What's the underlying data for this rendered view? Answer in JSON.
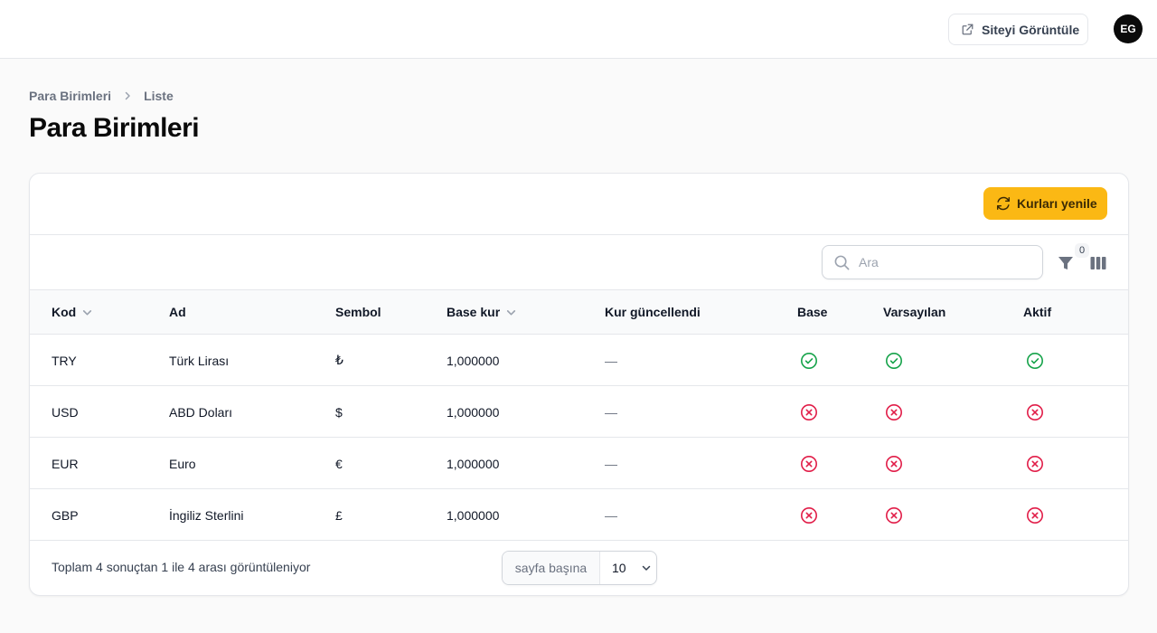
{
  "header": {
    "view_site_label": "Siteyi Görüntüle",
    "avatar_initials": "EG"
  },
  "breadcrumb": {
    "parent": "Para Birimleri",
    "current": "Liste"
  },
  "page": {
    "title": "Para Birimleri"
  },
  "toolbar": {
    "refresh_label": "Kurları yenile",
    "search_placeholder": "Ara",
    "filter_count": "0"
  },
  "table": {
    "columns": [
      "Kod",
      "Ad",
      "Sembol",
      "Base kur",
      "Kur güncellendi",
      "Base",
      "Varsayılan",
      "Aktif"
    ],
    "rows": [
      {
        "code": "TRY",
        "name": "Türk Lirası",
        "symbol": "₺",
        "base_rate": "1,000000",
        "updated": "—",
        "base": true,
        "default": true,
        "active": true
      },
      {
        "code": "USD",
        "name": "ABD Doları",
        "symbol": "$",
        "base_rate": "1,000000",
        "updated": "—",
        "base": false,
        "default": false,
        "active": false
      },
      {
        "code": "EUR",
        "name": "Euro",
        "symbol": "€",
        "base_rate": "1,000000",
        "updated": "—",
        "base": false,
        "default": false,
        "active": false
      },
      {
        "code": "GBP",
        "name": "İngiliz Sterlini",
        "symbol": "£",
        "base_rate": "1,000000",
        "updated": "—",
        "base": false,
        "default": false,
        "active": false
      }
    ]
  },
  "pagination": {
    "summary": "Toplam 4 sonuçtan 1 ile 4 arası görüntüleniyor",
    "per_page_label": "sayfa başına",
    "per_page_value": "10"
  },
  "icons": {
    "true": "check-circle-icon",
    "false": "x-circle-icon"
  },
  "colors": {
    "accent": "#fbb814",
    "success": "#16a34a",
    "danger": "#e11d48"
  }
}
